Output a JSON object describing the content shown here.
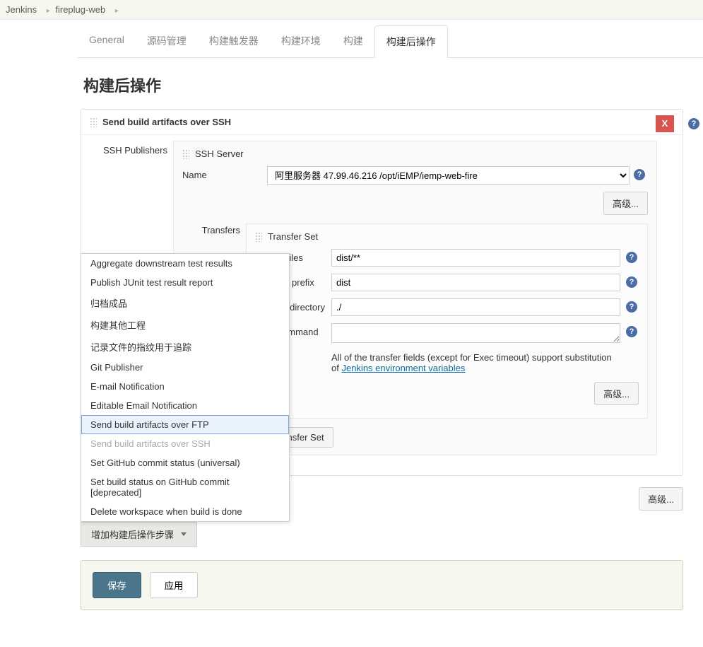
{
  "breadcrumb": {
    "items": [
      "Jenkins",
      "fireplug-web"
    ]
  },
  "tabs": [
    {
      "label": "General"
    },
    {
      "label": "源码管理"
    },
    {
      "label": "构建触发器"
    },
    {
      "label": "构建环境"
    },
    {
      "label": "构建"
    },
    {
      "label": "构建后操作"
    }
  ],
  "activeTab": 5,
  "pageTitle": "构建后操作",
  "block": {
    "title": "Send build artifacts over SSH",
    "closeLabel": "X",
    "publishersLabel": "SSH Publishers",
    "server": {
      "boxTitle": "SSH Server",
      "nameLabel": "Name",
      "nameValue": "阿里服务器 47.99.46.216 /opt/iEMP/iemp-web-fire",
      "advancedLabel": "高级..."
    },
    "transfers": {
      "label": "Transfers",
      "setTitle": "Transfer Set",
      "sourceLabel": "Source files",
      "sourceValue": "dist/**",
      "removePrefixLabel": "Remove prefix",
      "removePrefixValue": "dist",
      "remoteDirLabel": "Remote directory",
      "remoteDirValue": "./",
      "execLabel": "Exec command",
      "execValue": "",
      "noteA": "All of the transfer fields (except for Exec timeout) support substitution of ",
      "noteLink": "Jenkins environment variables",
      "advancedLabel": "高级...",
      "addTransferLabel": "Add Transfer Set"
    }
  },
  "bottomAdvanced": "高级...",
  "dropdown": {
    "items": [
      "Aggregate downstream test results",
      "Publish JUnit test result report",
      "归档成品",
      "构建其他工程",
      "记录文件的指纹用于追踪",
      "Git Publisher",
      "E-mail Notification",
      "Editable Email Notification",
      "Send build artifacts over FTP",
      "Send build artifacts over SSH",
      "Set GitHub commit status (universal)",
      "Set build status on GitHub commit [deprecated]",
      "Delete workspace when build is done"
    ],
    "selectedIndex": 8,
    "disabledIndex": 9
  },
  "addStepLabel": "增加构建后操作步骤",
  "footer": {
    "save": "保存",
    "apply": "应用"
  }
}
